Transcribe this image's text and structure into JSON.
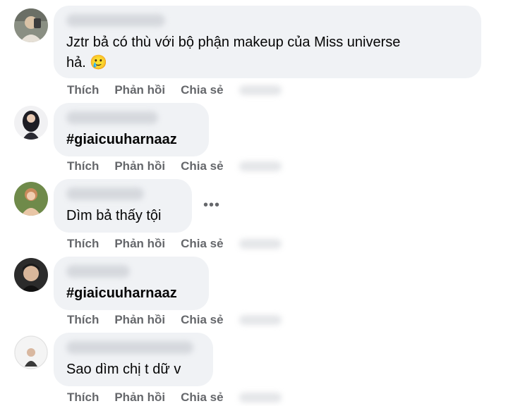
{
  "actions": {
    "like": "Thích",
    "reply": "Phản hồi",
    "share": "Chia sẻ"
  },
  "more_icon": "more-options-icon",
  "comments": [
    {
      "text": "Jztr bả có thù với bộ phận makeup của Miss universe\nhả. 🥲",
      "hashtag": false
    },
    {
      "text": "#giaicuuharnaaz",
      "hashtag": true
    },
    {
      "text": "Dìm bả thấy tội",
      "hashtag": false
    },
    {
      "text": "#giaicuuharnaaz",
      "hashtag": true
    },
    {
      "text": "Sao dìm chị t dữ v",
      "hashtag": false
    }
  ],
  "colors": {
    "bubble": "#f0f2f5",
    "action_text": "#65676b",
    "comment_text": "#050505"
  }
}
